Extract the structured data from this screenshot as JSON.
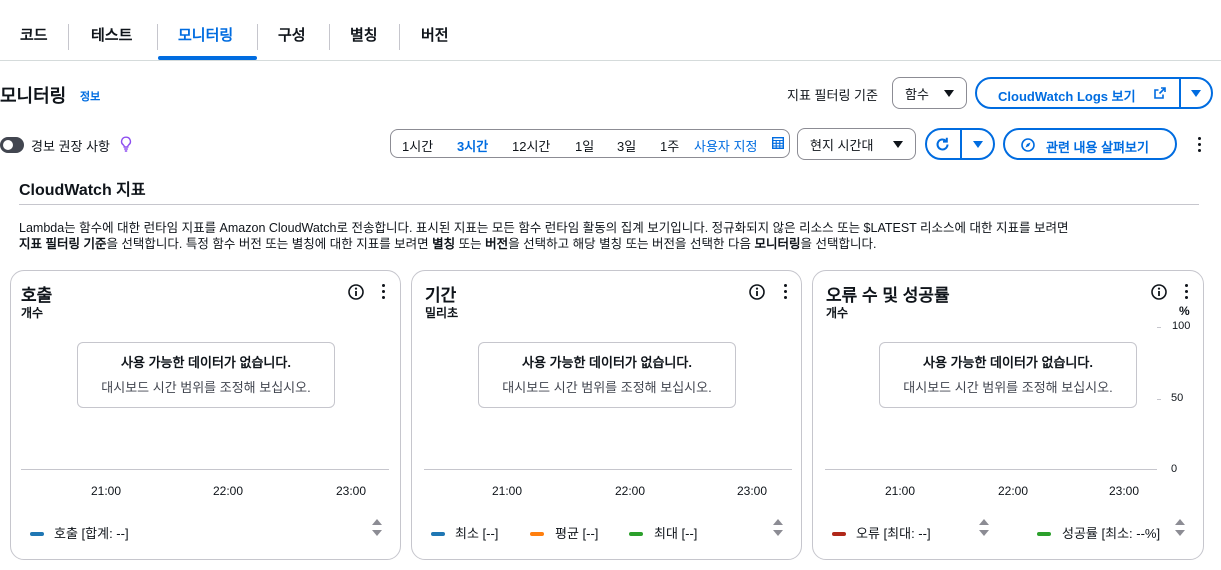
{
  "tabs": [
    {
      "label": "코드"
    },
    {
      "label": "테스트"
    },
    {
      "label": "모니터링",
      "active": true
    },
    {
      "label": "구성"
    },
    {
      "label": "별칭"
    },
    {
      "label": "버전"
    }
  ],
  "header": {
    "title": "모니터링",
    "info": "정보",
    "filter_label": "지표 필터링 기준",
    "filter_value": "함수",
    "logs_button": "CloudWatch Logs 보기"
  },
  "toolbar": {
    "alarm_toggle_label": "경보 권장 사항",
    "time_options": [
      "1시간",
      "3시간",
      "12시간",
      "1일",
      "3일",
      "1주"
    ],
    "time_selected": "3시간",
    "time_custom": "사용자 지정",
    "timezone": "현지 시간대",
    "explore_button": "관련 내용 살펴보기"
  },
  "section": {
    "title": "CloudWatch 지표",
    "desc_1": "Lambda는 함수에 대한 런타임 지표를 Amazon CloudWatch로 전송합니다. 표시된 지표는 모든 함수 런타임 활동의 집계 보기입니다. 정규화되지 않은 리소스 또는 $LATEST 리소스에 대한 지표를 보려면",
    "desc_b1": "지표 필터링 기준",
    "desc_2": "을 선택합니다. 특정 함수 버전 또는 별칭에 대한 지표를 보려면",
    "desc_b2": "별칭",
    "desc_3": "또는",
    "desc_b3": "버전",
    "desc_4": "을 선택하고 해당 별칭 또는 버전을 선택한 다음",
    "desc_b4": "모니터링",
    "desc_5": "을 선택합니다."
  },
  "cards": [
    {
      "title": "호출",
      "unit": "개수",
      "nodata_title": "사용 가능한 데이터가 없습니다.",
      "nodata_sub": "대시보드 시간 범위를 조정해 보십시오.",
      "xticks": [
        "21:00",
        "22:00",
        "23:00"
      ],
      "legend": [
        {
          "label": "호출 [합계: --]",
          "color": "#1f77b4"
        }
      ]
    },
    {
      "title": "기간",
      "unit": "밀리초",
      "nodata_title": "사용 가능한 데이터가 없습니다.",
      "nodata_sub": "대시보드 시간 범위를 조정해 보십시오.",
      "xticks": [
        "21:00",
        "22:00",
        "23:00"
      ],
      "legend": [
        {
          "label": "최소 [--]",
          "color": "#1f77b4"
        },
        {
          "label": "평균 [--]",
          "color": "#ff7f0e"
        },
        {
          "label": "최대 [--]",
          "color": "#2ca02c"
        }
      ]
    },
    {
      "title": "오류 수 및 성공률",
      "unit": "개수",
      "unit_right": "%",
      "nodata_title": "사용 가능한 데이터가 없습니다.",
      "nodata_sub": "대시보드 시간 범위를 조정해 보십시오.",
      "xticks": [
        "21:00",
        "22:00",
        "23:00"
      ],
      "yticks": [
        "100",
        "50",
        "0"
      ],
      "legend": [
        {
          "label": "오류 [최대: --]",
          "color": "#d62728"
        },
        {
          "label": "성공률 [최소: --%]",
          "color": "#2ca02c"
        }
      ]
    }
  ]
}
